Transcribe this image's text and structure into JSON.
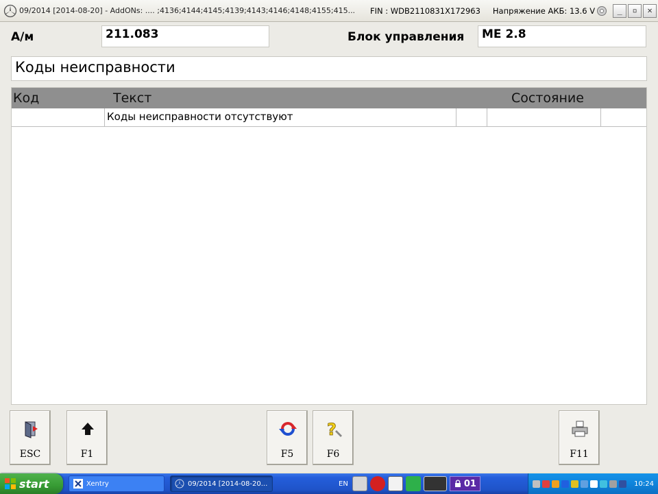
{
  "window": {
    "title": "09/2014 [2014-08-20] - AddONs:  .... ;4136;4144;4145;4139;4143;4146;4148;4155;415...",
    "fin": "FIN : WDB2110831X172963",
    "voltage": "Напряжение АКБ: 13.6 V",
    "min_glyph": "_",
    "max_glyph": "▫",
    "close_glyph": "✕"
  },
  "header": {
    "model_label": "А/м",
    "model_value": "211.083",
    "ecu_label": "Блок управления",
    "ecu_value": "ME 2.8"
  },
  "section_title": "Коды неисправности",
  "table": {
    "columns": [
      "Код",
      "Текст",
      "Состояние"
    ],
    "rows": [
      {
        "code": "",
        "text": "Коды неисправности отсутствуют",
        "c3": "",
        "state": "",
        "c5": ""
      }
    ]
  },
  "fkeys": {
    "esc": "ESC",
    "f1": "F1",
    "f5": "F5",
    "f6": "F6",
    "f11": "F11"
  },
  "taskbar": {
    "start": "start",
    "task1": "Xentry",
    "task2": "09/2014 [2014-08-20...",
    "lang": "EN",
    "counter": "01",
    "clock": "10:24"
  },
  "colors": {
    "table_header": "#8f8f8f",
    "taskbar": "#245edb",
    "start_button": "#379b34"
  }
}
